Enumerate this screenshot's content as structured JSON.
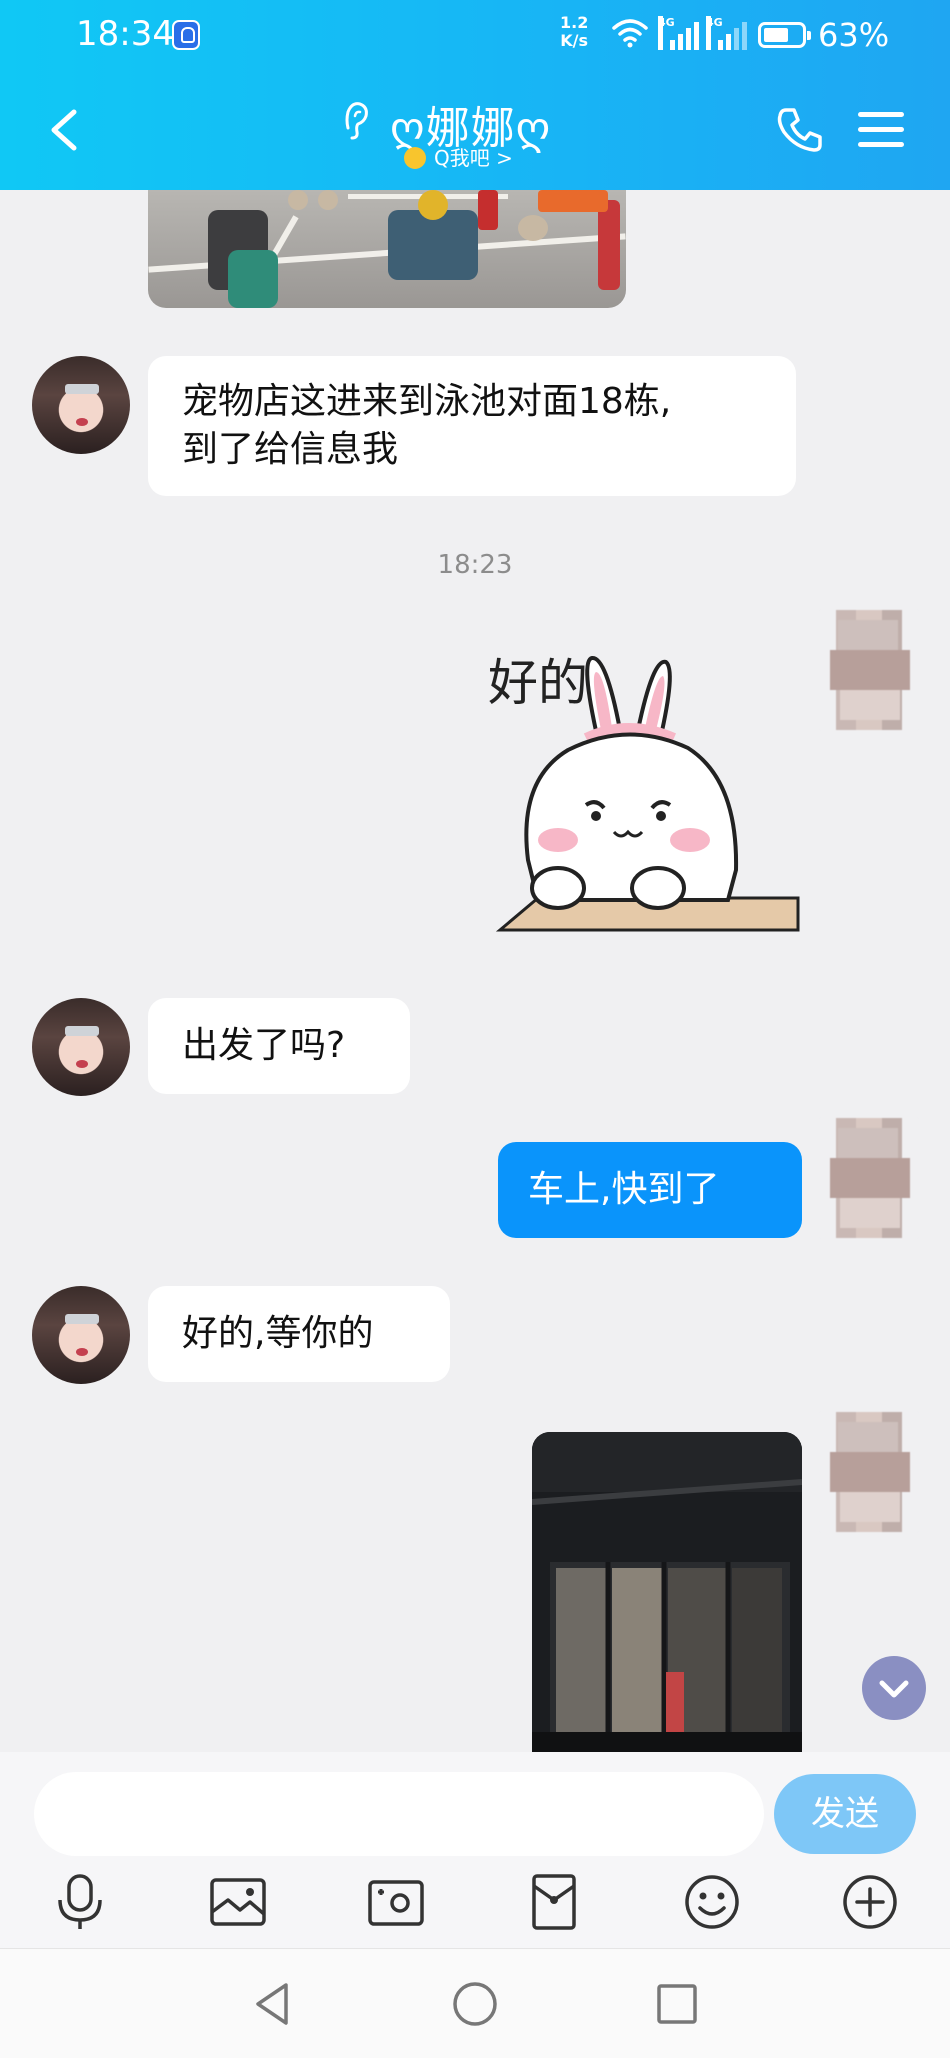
{
  "status_bar": {
    "time": "18:34",
    "net_speed_value": "1.2",
    "net_speed_unit": "K/s",
    "signal1_label": "4G",
    "signal2_label": "4G",
    "battery": "63%"
  },
  "header": {
    "contact_name": "ღ娜娜ღ",
    "subtitle": "Q我吧 >",
    "accent": "#12b8f5"
  },
  "messages": [
    {
      "type": "image",
      "direction": "in"
    },
    {
      "type": "text",
      "direction": "in",
      "text_line1": "宠物店这进来到泳池对面18栋,",
      "text_line2": "到了给信息我"
    },
    {
      "type": "timestamp",
      "text": "18:23"
    },
    {
      "type": "sticker",
      "direction": "out",
      "sticker_text": "好的!"
    },
    {
      "type": "text",
      "direction": "in",
      "text": "出发了吗?"
    },
    {
      "type": "text",
      "direction": "out",
      "text": "车上,快到了"
    },
    {
      "type": "text",
      "direction": "in",
      "text": "好的,等你的"
    },
    {
      "type": "image",
      "direction": "out"
    }
  ],
  "input": {
    "value": "",
    "send_label": "发送",
    "send_color": "#7ec7f7"
  },
  "toolbar": {
    "icons": [
      "microphone-icon",
      "image-icon",
      "camera-icon",
      "red-packet-icon",
      "emoji-icon",
      "plus-icon"
    ]
  },
  "nav": {
    "icons": [
      "back-triangle-icon",
      "home-circle-icon",
      "recent-square-icon"
    ]
  }
}
